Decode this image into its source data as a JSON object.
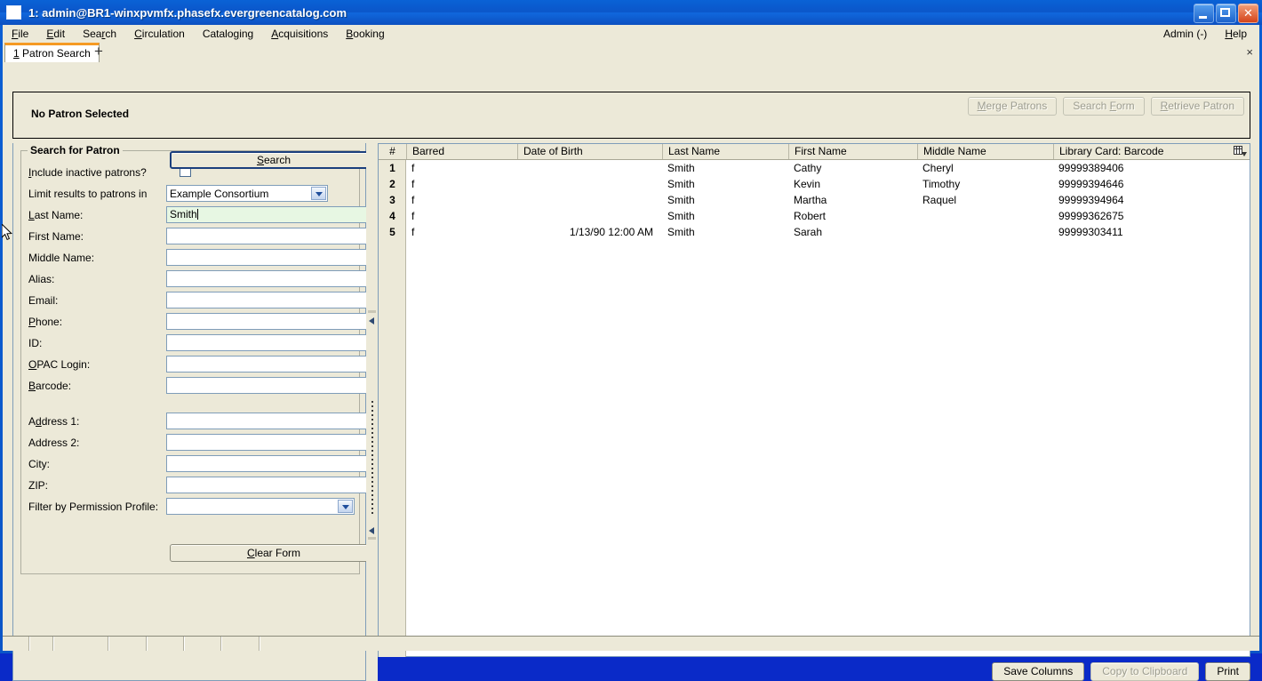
{
  "window": {
    "title": "1: admin@BR1-winxpvmfx.phasefx.evergreencatalog.com",
    "minimize_label": "Minimize",
    "maximize_label": "Maximize",
    "close_label": "Close"
  },
  "menubar": {
    "items": [
      {
        "label": "File",
        "accel": "F"
      },
      {
        "label": "Edit",
        "accel": "E"
      },
      {
        "label": "Search",
        "accel": "r"
      },
      {
        "label": "Circulation",
        "accel": "C"
      },
      {
        "label": "Cataloging",
        "accel": "g"
      },
      {
        "label": "Acquisitions",
        "accel": "A"
      },
      {
        "label": "Booking",
        "accel": "B"
      }
    ],
    "admin_label": "Admin (-)",
    "help_label": "Help"
  },
  "tabs": {
    "active": {
      "number": "1",
      "label": "Patron Search"
    },
    "new_tab_label": "+",
    "close_label": "×"
  },
  "patron_header": {
    "status": "No Patron Selected",
    "buttons": [
      {
        "label": "Merge Patrons",
        "accel": "M",
        "disabled": true
      },
      {
        "label": "Search Form",
        "accel": "F",
        "disabled": true
      },
      {
        "label": "Retrieve Patron",
        "accel": "R",
        "disabled": true
      }
    ]
  },
  "search_form": {
    "legend": "Search for Patron",
    "fields": [
      {
        "label": "Include inactive patrons?",
        "accel": "I",
        "type": "checkbox",
        "value": "",
        "checked": false
      },
      {
        "label": "Limit results to patrons in",
        "accel": "",
        "type": "select",
        "value": "Example Consortium"
      },
      {
        "label": "Last Name:",
        "accel": "L",
        "type": "text",
        "value": "Smith",
        "focused": true
      },
      {
        "label": "First Name:",
        "accel": "",
        "type": "text",
        "value": ""
      },
      {
        "label": "Middle Name:",
        "accel": "",
        "type": "text",
        "value": ""
      },
      {
        "label": "Alias:",
        "accel": "",
        "type": "text",
        "value": ""
      },
      {
        "label": "Email:",
        "accel": "",
        "type": "text",
        "value": ""
      },
      {
        "label": "Phone:",
        "accel": "P",
        "type": "text",
        "value": ""
      },
      {
        "label": "ID:",
        "accel": "",
        "type": "text",
        "value": ""
      },
      {
        "label": "OPAC Login:",
        "accel": "O",
        "type": "text",
        "value": ""
      },
      {
        "label": "Barcode:",
        "accel": "B",
        "type": "text",
        "value": ""
      },
      {
        "label": "Address 1:",
        "accel": "d",
        "type": "text",
        "value": ""
      },
      {
        "label": "Address 2:",
        "accel": "",
        "type": "text",
        "value": ""
      },
      {
        "label": "City:",
        "accel": "",
        "type": "text",
        "value": ""
      },
      {
        "label": "ZIP:",
        "accel": "",
        "type": "text",
        "value": ""
      },
      {
        "label": "Filter by Permission Profile:",
        "accel": "",
        "type": "select",
        "value": ""
      }
    ],
    "search_button": "Search",
    "search_accel": "S",
    "clear_button": "Clear Form",
    "clear_accel": "C"
  },
  "results": {
    "columns": [
      {
        "key": "num",
        "label": "#"
      },
      {
        "key": "barred",
        "label": "Barred"
      },
      {
        "key": "dob",
        "label": "Date of Birth"
      },
      {
        "key": "last",
        "label": "Last Name"
      },
      {
        "key": "first",
        "label": "First Name"
      },
      {
        "key": "middle",
        "label": "Middle Name"
      },
      {
        "key": "card",
        "label": "Library Card: Barcode"
      }
    ],
    "rows": [
      {
        "num": "1",
        "barred": "f",
        "dob": "",
        "last": "Smith",
        "first": "Cathy",
        "middle": "Cheryl",
        "card": "99999389406"
      },
      {
        "num": "2",
        "barred": "f",
        "dob": "",
        "last": "Smith",
        "first": "Kevin",
        "middle": "Timothy",
        "card": "99999394646"
      },
      {
        "num": "3",
        "barred": "f",
        "dob": "",
        "last": "Smith",
        "first": "Martha",
        "middle": "Raquel",
        "card": "99999394964"
      },
      {
        "num": "4",
        "barred": "f",
        "dob": "",
        "last": "Smith",
        "first": "Robert",
        "middle": "",
        "card": "99999362675"
      },
      {
        "num": "5",
        "barred": "f",
        "dob": "1/13/90 12:00 AM",
        "last": "Smith",
        "first": "Sarah",
        "middle": "",
        "card": "99999303411"
      }
    ],
    "column_picker_label": "Column picker",
    "buttons": [
      {
        "label": "Save Columns",
        "disabled": false
      },
      {
        "label": "Copy to Clipboard",
        "disabled": true
      },
      {
        "label": "Print",
        "disabled": false
      }
    ]
  },
  "statusbar": {
    "segments": [
      "",
      "",
      "",
      "",
      "",
      "",
      ""
    ]
  },
  "colors": {
    "titlebar": "#0b56c9",
    "face": "#ece9d8",
    "tab_accent": "#f59a23",
    "field_border": "#7f9db9",
    "focus_field": "#e7f7e3",
    "default_button_border": "#1b3f7d"
  }
}
